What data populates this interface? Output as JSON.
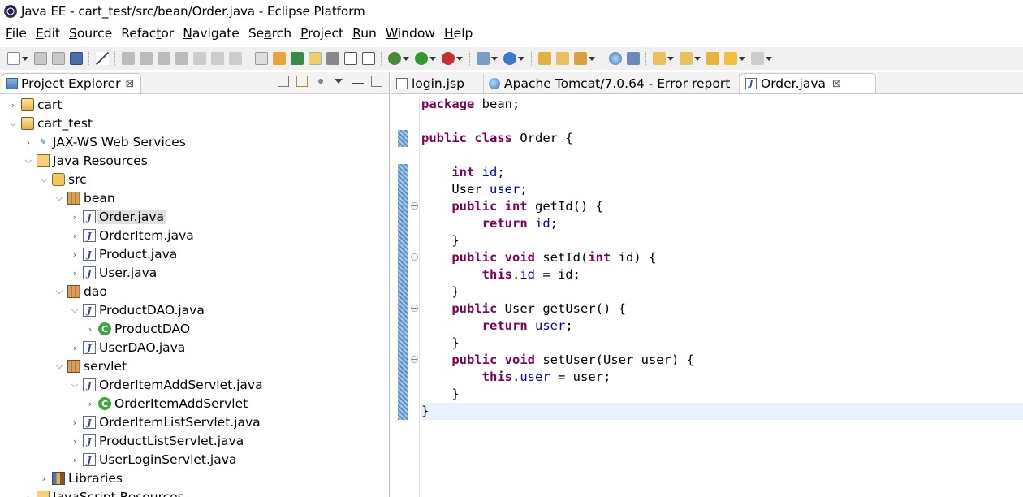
{
  "window": {
    "title": "Java EE - cart_test/src/bean/Order.java - Eclipse Platform"
  },
  "menu": [
    {
      "mnemonic": "F",
      "rest": "ile"
    },
    {
      "mnemonic": "E",
      "rest": "dit"
    },
    {
      "mnemonic": "S",
      "rest": "ource"
    },
    {
      "pre": "Refac",
      "mnemonic": "t",
      "rest": "or"
    },
    {
      "mnemonic": "N",
      "rest": "avigate"
    },
    {
      "pre": "Se",
      "mnemonic": "a",
      "rest": "rch"
    },
    {
      "mnemonic": "P",
      "rest": "roject"
    },
    {
      "mnemonic": "R",
      "rest": "un"
    },
    {
      "mnemonic": "W",
      "rest": "indow"
    },
    {
      "mnemonic": "H",
      "rest": "elp"
    }
  ],
  "project_explorer": {
    "title": "Project Explorer",
    "close_glyph": "⊠",
    "tree": [
      {
        "label": "cart",
        "depth": 0,
        "twisty": ">",
        "icon": "project-icon"
      },
      {
        "label": "cart_test",
        "depth": 0,
        "twisty": "v",
        "icon": "project-icon"
      },
      {
        "label": "JAX-WS Web Services",
        "depth": 1,
        "twisty": ">",
        "icon": "web-services-icon"
      },
      {
        "label": "Java Resources",
        "depth": 1,
        "twisty": "v",
        "icon": "java-resources-icon"
      },
      {
        "label": "src",
        "depth": 2,
        "twisty": "v",
        "icon": "source-folder-icon"
      },
      {
        "label": "bean",
        "depth": 3,
        "twisty": "v",
        "icon": "package-icon"
      },
      {
        "label": "Order.java",
        "depth": 4,
        "twisty": ">",
        "icon": "java-file-icon",
        "selected": true
      },
      {
        "label": "OrderItem.java",
        "depth": 4,
        "twisty": ">",
        "icon": "java-file-icon"
      },
      {
        "label": "Product.java",
        "depth": 4,
        "twisty": ">",
        "icon": "java-file-icon"
      },
      {
        "label": "User.java",
        "depth": 4,
        "twisty": ">",
        "icon": "java-file-icon"
      },
      {
        "label": "dao",
        "depth": 3,
        "twisty": "v",
        "icon": "package-icon"
      },
      {
        "label": "ProductDAO.java",
        "depth": 4,
        "twisty": "v",
        "icon": "java-file-icon"
      },
      {
        "label": "ProductDAO",
        "depth": 5,
        "twisty": ">",
        "icon": "class-icon"
      },
      {
        "label": "UserDAO.java",
        "depth": 4,
        "twisty": ">",
        "icon": "java-file-icon"
      },
      {
        "label": "servlet",
        "depth": 3,
        "twisty": "v",
        "icon": "package-icon"
      },
      {
        "label": "OrderItemAddServlet.java",
        "depth": 4,
        "twisty": "v",
        "icon": "java-file-icon"
      },
      {
        "label": "OrderItemAddServlet",
        "depth": 5,
        "twisty": ">",
        "icon": "class-icon"
      },
      {
        "label": "OrderItemListServlet.java",
        "depth": 4,
        "twisty": ">",
        "icon": "java-file-icon"
      },
      {
        "label": "ProductListServlet.java",
        "depth": 4,
        "twisty": ">",
        "icon": "java-file-icon"
      },
      {
        "label": "UserLoginServlet.java",
        "depth": 4,
        "twisty": ">",
        "icon": "java-file-icon"
      },
      {
        "label": "Libraries",
        "depth": 2,
        "twisty": ">",
        "icon": "libraries-icon"
      },
      {
        "label": "JavaScript Resources",
        "depth": 1,
        "twisty": ">",
        "icon": "javascript-resources-icon"
      }
    ]
  },
  "editor": {
    "tabs": [
      {
        "label": "login.jsp",
        "icon": "jsp-file-icon",
        "active": false
      },
      {
        "label": "Apache Tomcat/7.0.64 - Error report",
        "icon": "web-browser-icon",
        "active": false
      },
      {
        "label": "Order.java",
        "icon": "java-file-icon",
        "active": true,
        "close_glyph": "⊠"
      }
    ],
    "code": [
      [
        [
          "k",
          "package"
        ],
        [
          "t",
          " bean;"
        ]
      ],
      [],
      [
        [
          "k",
          "public"
        ],
        [
          "t",
          " "
        ],
        [
          "k",
          "class"
        ],
        [
          "t",
          " Order {"
        ]
      ],
      [],
      [
        [
          "t",
          "    "
        ],
        [
          "k",
          "int"
        ],
        [
          "t",
          " "
        ],
        [
          "f",
          "id"
        ],
        [
          "t",
          ";"
        ]
      ],
      [
        [
          "t",
          "    User "
        ],
        [
          "f",
          "user"
        ],
        [
          "t",
          ";"
        ]
      ],
      [
        [
          "t",
          "    "
        ],
        [
          "k",
          "public"
        ],
        [
          "t",
          " "
        ],
        [
          "k",
          "int"
        ],
        [
          "t",
          " getId() {"
        ]
      ],
      [
        [
          "t",
          "        "
        ],
        [
          "k",
          "return"
        ],
        [
          "t",
          " "
        ],
        [
          "f",
          "id"
        ],
        [
          "t",
          ";"
        ]
      ],
      [
        [
          "t",
          "    }"
        ]
      ],
      [
        [
          "t",
          "    "
        ],
        [
          "k",
          "public"
        ],
        [
          "t",
          " "
        ],
        [
          "k",
          "void"
        ],
        [
          "t",
          " setId("
        ],
        [
          "k",
          "int"
        ],
        [
          "t",
          " id) {"
        ]
      ],
      [
        [
          "t",
          "        "
        ],
        [
          "k",
          "this"
        ],
        [
          "t",
          "."
        ],
        [
          "f",
          "id"
        ],
        [
          "t",
          " = id;"
        ]
      ],
      [
        [
          "t",
          "    }"
        ]
      ],
      [
        [
          "t",
          "    "
        ],
        [
          "k",
          "public"
        ],
        [
          "t",
          " User getUser() {"
        ]
      ],
      [
        [
          "t",
          "        "
        ],
        [
          "k",
          "return"
        ],
        [
          "t",
          " "
        ],
        [
          "f",
          "user"
        ],
        [
          "t",
          ";"
        ]
      ],
      [
        [
          "t",
          "    }"
        ]
      ],
      [
        [
          "t",
          "    "
        ],
        [
          "k",
          "public"
        ],
        [
          "t",
          " "
        ],
        [
          "k",
          "void"
        ],
        [
          "t",
          " setUser(User user) {"
        ]
      ],
      [
        [
          "t",
          "        "
        ],
        [
          "k",
          "this"
        ],
        [
          "t",
          "."
        ],
        [
          "f",
          "user"
        ],
        [
          "t",
          " = user;"
        ]
      ],
      [
        [
          "t",
          "    }"
        ]
      ],
      [
        [
          "t",
          "}"
        ]
      ]
    ],
    "current_line": 19
  },
  "colors": {
    "keyword": "#7f0055",
    "field": "#0000c0",
    "current_line_highlight": "#e8f2fe",
    "selection": "#e0e0e0"
  }
}
